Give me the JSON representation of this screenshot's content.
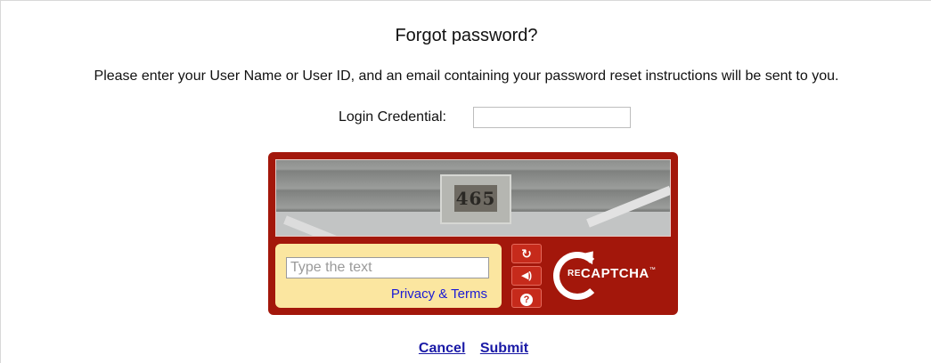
{
  "page": {
    "title": "Forgot password?",
    "instructions": "Please enter your User Name or User ID, and an email containing your password reset instructions will be sent to you."
  },
  "credential": {
    "label": "Login Credential:",
    "value": ""
  },
  "captcha": {
    "image_text": "465",
    "input_placeholder": "Type the text",
    "privacy_label": "Privacy & Terms",
    "wordmark_re": "RE",
    "wordmark": "CAPTCHA",
    "wordmark_tm": "™",
    "colors": {
      "frame": "#a3170b",
      "entry_bg": "#fbe6a0",
      "button": "#c62a1b"
    },
    "icons": [
      "reload-icon",
      "audio-icon",
      "help-icon"
    ]
  },
  "actions": {
    "cancel_label": "Cancel",
    "submit_label": "Submit",
    "link_color": "#1a1aa6"
  }
}
